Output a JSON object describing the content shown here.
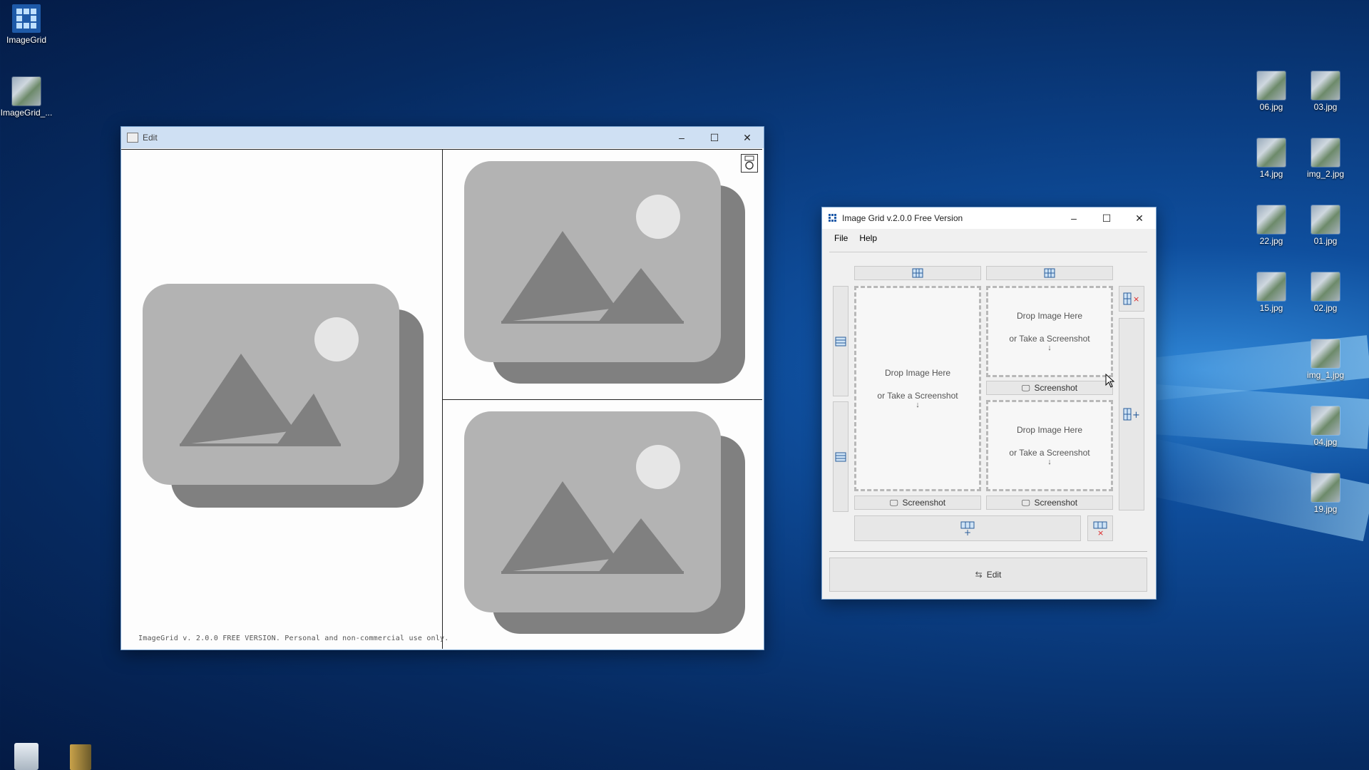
{
  "desktop": {
    "icons_left": [
      {
        "label": "ImageGrid"
      },
      {
        "label": "ImageGrid_..."
      }
    ],
    "icons_right": [
      {
        "label": "06.jpg"
      },
      {
        "label": "03.jpg"
      },
      {
        "label": "14.jpg"
      },
      {
        "label": "img_2.jpg"
      },
      {
        "label": "22.jpg"
      },
      {
        "label": "01.jpg"
      },
      {
        "label": "15.jpg"
      },
      {
        "label": "02.jpg"
      },
      {
        "label": "img_1.jpg"
      },
      {
        "label": "04.jpg"
      },
      {
        "label": "19.jpg"
      }
    ],
    "taskbar_icons": [
      "recycle-bin-icon",
      "folder-icon"
    ]
  },
  "edit_window": {
    "title": "Edit",
    "footer": "ImageGrid v. 2.0.0 FREE VERSION. Personal and non-commercial use only.",
    "save_icon": "save-icon"
  },
  "grid_window": {
    "title": "Image Grid v.2.0.0 Free Version",
    "menu": [
      "File",
      "Help"
    ],
    "drop_label": "Drop Image Here",
    "drop_sub": "or Take a Screenshot",
    "screenshot_label": "Screenshot",
    "edit_label": "Edit"
  },
  "colors": {
    "titlebar_active": "#ffffff",
    "titlebar_inactive": "#cfe0f3",
    "placeholder_front": "#b3b3b3",
    "placeholder_back": "#808080"
  }
}
